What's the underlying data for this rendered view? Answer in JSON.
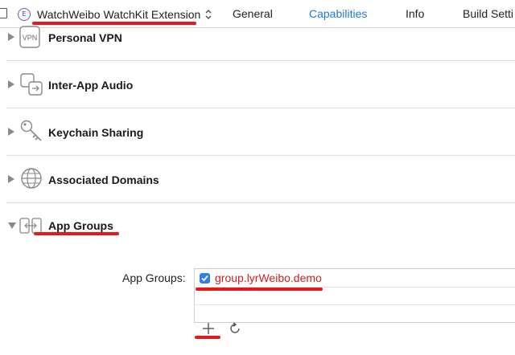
{
  "header": {
    "ext_badge": "E",
    "target_name": "WatchWeibo WatchKit Extension",
    "tabs": [
      {
        "label": "General",
        "active": false
      },
      {
        "label": "Capabilities",
        "active": true
      },
      {
        "label": "Info",
        "active": false
      },
      {
        "label": "Build Setti",
        "active": false
      }
    ]
  },
  "capabilities": [
    {
      "label": "Personal VPN",
      "icon": "vpn-icon",
      "vpn_text": "VPN",
      "expanded": false
    },
    {
      "label": "Inter-App Audio",
      "icon": "inter-app-audio-icon",
      "expanded": false
    },
    {
      "label": "Keychain Sharing",
      "icon": "key-icon",
      "expanded": false
    },
    {
      "label": "Associated Domains",
      "icon": "globe-icon",
      "expanded": false
    },
    {
      "label": "App Groups",
      "icon": "app-groups-icon",
      "expanded": true
    }
  ],
  "app_groups": {
    "field_label": "App Groups:",
    "items": [
      {
        "name": "group.lyrWeibo.demo",
        "checked": true
      }
    ]
  },
  "colors": {
    "accent": "#1f78d1",
    "annotation_red": "#e8181a",
    "checkbox_blue": "#2c80e8"
  }
}
